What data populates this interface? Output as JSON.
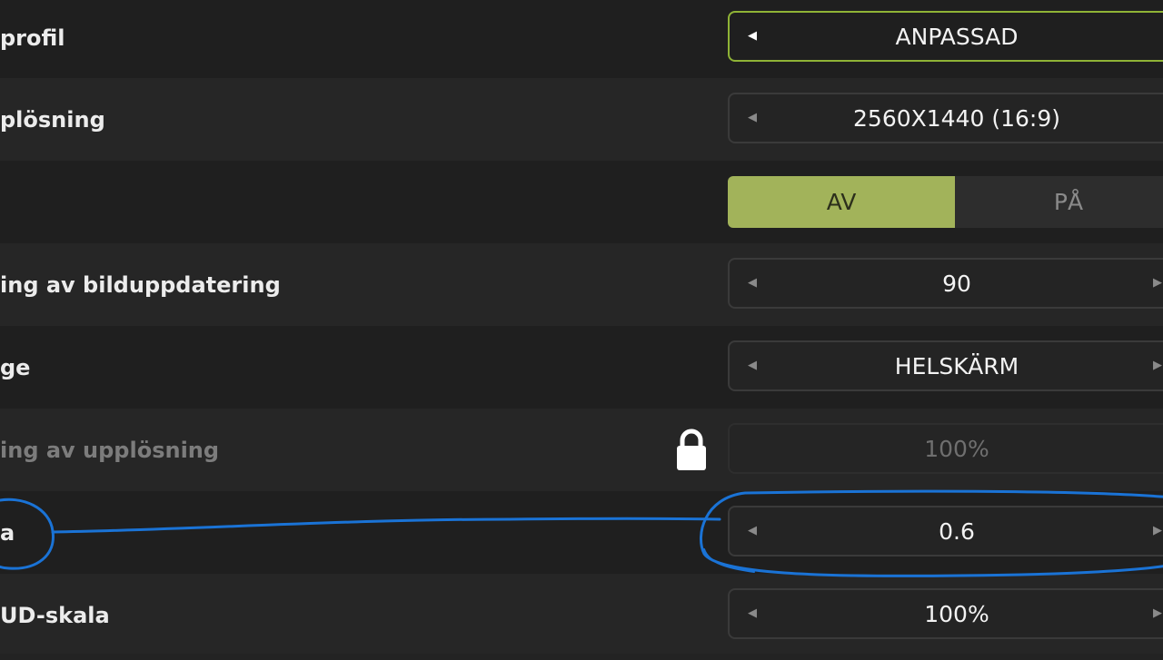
{
  "settings": [
    {
      "label": "profil",
      "value": "ANPASSAD"
    },
    {
      "label": "plösning",
      "value": "2560X1440 (16:9)"
    },
    {
      "label": "",
      "toggle": {
        "off": "AV",
        "on": "PÅ"
      }
    },
    {
      "label": "ing av bilduppdatering",
      "value": "90"
    },
    {
      "label": "ge",
      "value": "HELSKÄRM"
    },
    {
      "label": "ing av upplösning",
      "value": "100%"
    },
    {
      "label": "a",
      "value": "0.6"
    },
    {
      "label": "UD-skala",
      "value": "100%"
    }
  ],
  "colors": {
    "accent": "#8fb336",
    "toggle_active": "#a2b35a",
    "annotation": "#1a73d6"
  },
  "icons": {
    "lock": "lock-icon",
    "arrow_left": "arrow-left-icon",
    "arrow_right": "arrow-right-icon"
  }
}
